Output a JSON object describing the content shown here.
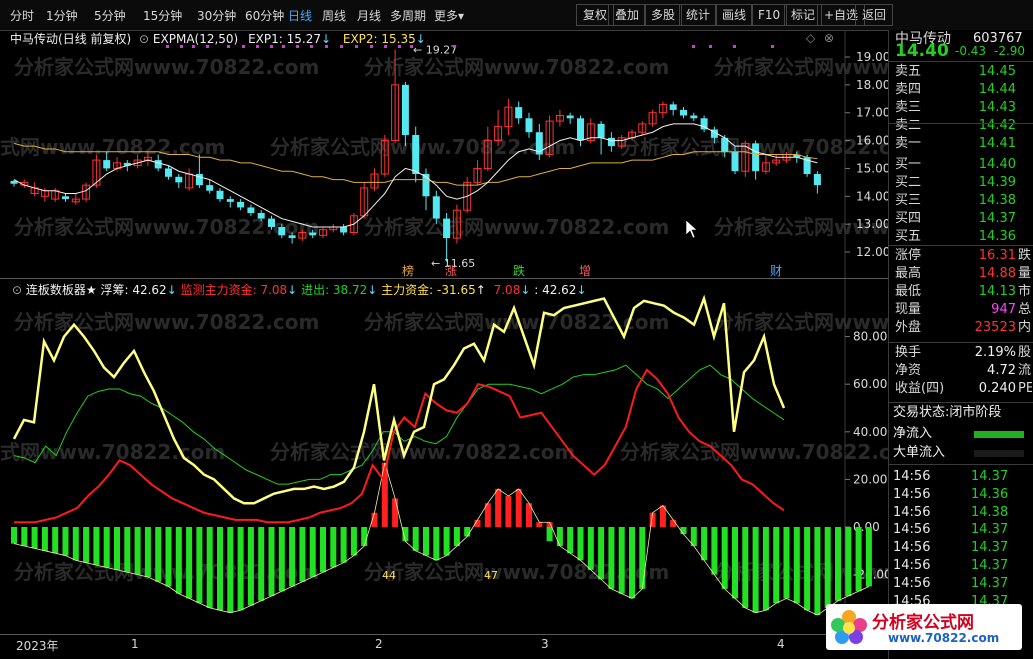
{
  "toolbar": {
    "periods": [
      "分时",
      "1分钟",
      "5分钟",
      "15分钟",
      "30分钟",
      "60分钟",
      "日线",
      "周线",
      "月线",
      "多周期",
      "更多"
    ],
    "active_period": "日线",
    "more_arrow": "▾",
    "buttons": [
      "复权",
      "叠加",
      "多股",
      "统计",
      "画线",
      "F10",
      "标记",
      "+自选",
      "返回"
    ]
  },
  "main_chart": {
    "stock_name": "中马传动",
    "period_label": "(日线 前复权)",
    "indicator": "EXPMA(12,50)",
    "exp1_label": "EXP1: 15.27",
    "exp1_arrow": "↓",
    "exp2_label": "EXP2: 15.35",
    "exp2_arrow": "↓",
    "high_marker": "19.27",
    "low_marker": "11.65",
    "y_ticks": [
      "19.00",
      "18.00",
      "17.00",
      "16.00",
      "15.00",
      "14.00",
      "13.00",
      "12.00"
    ],
    "tags": [
      "榜",
      "涨",
      "跌",
      "增",
      "财"
    ],
    "watermark": "分析家公式网www.70822.com"
  },
  "sub_chart": {
    "title": "连板数板器★",
    "float_label": "浮筹: 42.62",
    "monitor_label": "监测主力资金: 7.08",
    "inout_label": "进出: 38.72",
    "main_fund_label": "主力资金: -31.65",
    "extra1": "7.08",
    "extra2": ": 42.62",
    "arrow_down": "↓",
    "arrow_up": "↑",
    "y_ticks": [
      "80.00",
      "60.00",
      "40.00",
      "20.00",
      "0.00",
      "-20.00"
    ],
    "annotations": [
      "44",
      "47"
    ]
  },
  "x_axis": {
    "labels": [
      "2023年",
      "1",
      "2",
      "3",
      "4"
    ]
  },
  "quote": {
    "name": "中马传动",
    "code": "603767",
    "price": "14.40",
    "change": "-0.43",
    "change_pct": "-2.90",
    "asks": [
      {
        "label": "卖五",
        "price": "14.45"
      },
      {
        "label": "卖四",
        "price": "14.44"
      },
      {
        "label": "卖三",
        "price": "14.43"
      },
      {
        "label": "卖二",
        "price": "14.42"
      },
      {
        "label": "卖一",
        "price": "14.41"
      }
    ],
    "bids": [
      {
        "label": "买一",
        "price": "14.40"
      },
      {
        "label": "买二",
        "price": "14.39"
      },
      {
        "label": "买三",
        "price": "14.38"
      },
      {
        "label": "买四",
        "price": "14.37"
      },
      {
        "label": "买五",
        "price": "14.36"
      }
    ],
    "stats": [
      {
        "label": "涨停",
        "value": "16.31",
        "tail": "跌",
        "color": "#ff3232"
      },
      {
        "label": "最高",
        "value": "14.88",
        "tail": "量",
        "color": "#ff3232"
      },
      {
        "label": "最低",
        "value": "14.13",
        "tail": "市",
        "color": "#22d022"
      },
      {
        "label": "现量",
        "value": "947",
        "tail": "总",
        "color": "#ff44ff"
      },
      {
        "label": "外盘",
        "value": "23523",
        "tail": "内",
        "color": "#ff3232"
      }
    ],
    "stats2": [
      {
        "label": "换手",
        "value": "2.19%",
        "tail": "股"
      },
      {
        "label": "净资",
        "value": "4.72",
        "tail": "流"
      },
      {
        "label": "收益(四)",
        "value": "0.240",
        "tail": "PE"
      }
    ],
    "trade_status_label": "交易状态:",
    "trade_status_value": "闭市阶段",
    "net_inflow_label": "净流入",
    "big_inflow_label": "大单流入",
    "ticks": [
      {
        "time": "14:56",
        "price": "14.37"
      },
      {
        "time": "14:56",
        "price": "14.36"
      },
      {
        "time": "14:56",
        "price": "14.38"
      },
      {
        "time": "14:56",
        "price": "14.37"
      },
      {
        "time": "14:56",
        "price": "14.37"
      },
      {
        "time": "14:56",
        "price": "14.37"
      },
      {
        "time": "14:56",
        "price": "14.37"
      },
      {
        "time": "14:56",
        "price": "14.37"
      }
    ]
  },
  "logo": {
    "title": "分析家公式网",
    "url": "www.70822.com"
  }
}
